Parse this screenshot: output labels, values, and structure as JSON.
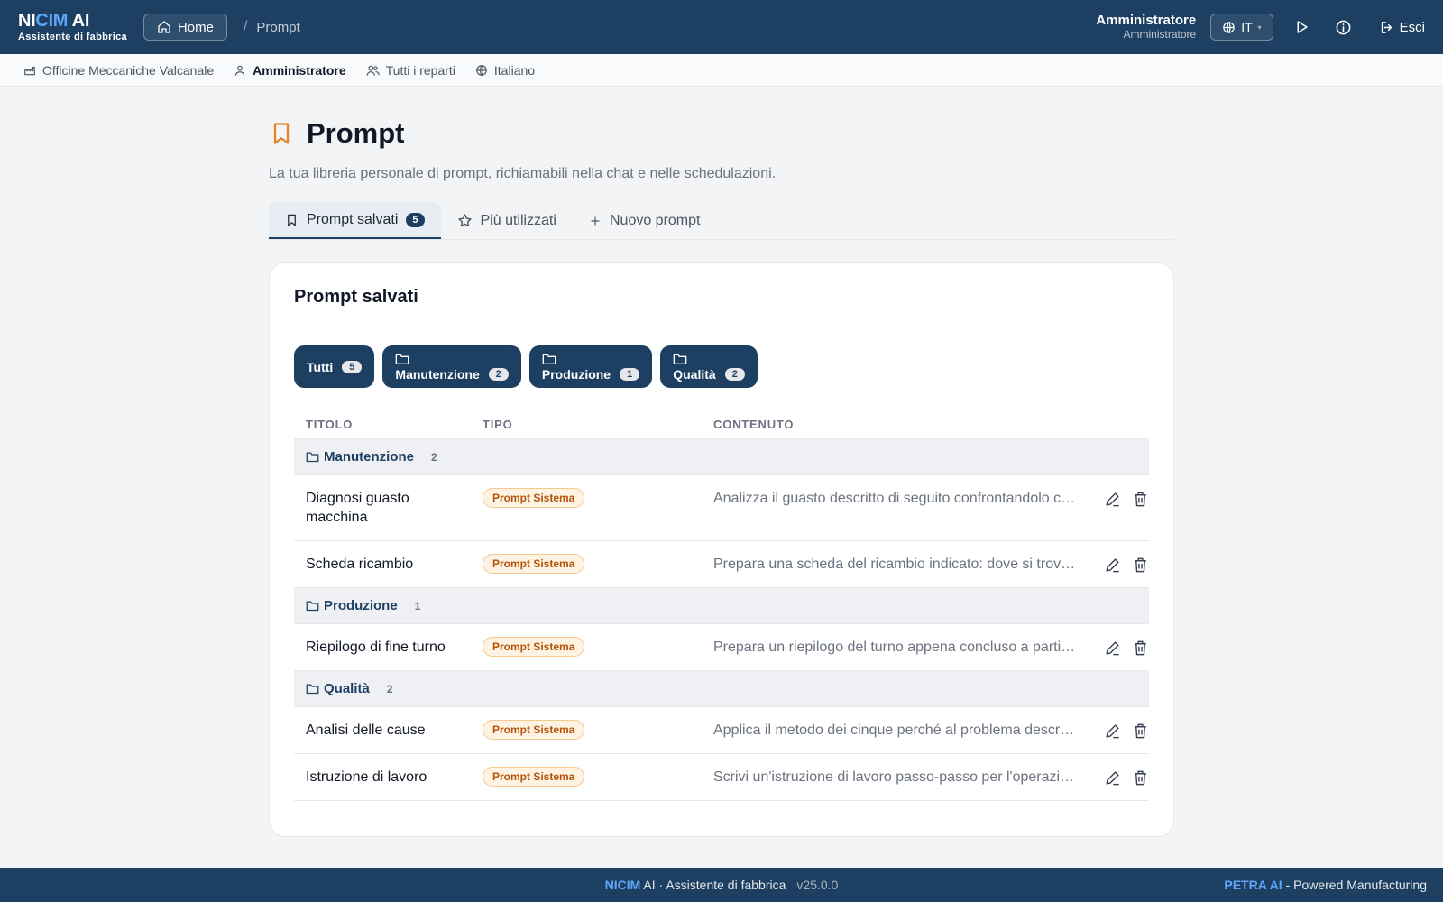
{
  "brand": {
    "name_a": "NI",
    "name_b": "CIM",
    "name_c": " AI",
    "subtitle": "Assistente di fabbrica"
  },
  "header": {
    "home_label": "Home",
    "breadcrumb_sep": "/",
    "breadcrumb_current": "Prompt",
    "user_name": "Amministratore",
    "user_role": "Amministratore",
    "language": "IT",
    "logout_label": "Esci"
  },
  "subbar": {
    "company": "Officine Meccaniche Valcanale",
    "user": "Amministratore",
    "departments": "Tutti i reparti",
    "language": "Italiano"
  },
  "page": {
    "title": "Prompt",
    "description": "La tua libreria personale di prompt, richiamabili nella chat e nelle schedulazioni."
  },
  "tabs": [
    {
      "label": "Prompt salvati",
      "count": "5"
    },
    {
      "label": "Più utilizzati"
    },
    {
      "label": "Nuovo prompt"
    }
  ],
  "card": {
    "title": "Prompt salvati",
    "filters": [
      {
        "label": "Tutti",
        "count": "5"
      },
      {
        "label": "Manutenzione",
        "count": "2"
      },
      {
        "label": "Produzione",
        "count": "1"
      },
      {
        "label": "Qualità",
        "count": "2"
      }
    ],
    "columns": {
      "title": "TITOLO",
      "type": "TIPO",
      "content": "CONTENUTO"
    },
    "groups": [
      {
        "name": "Manutenzione",
        "count": "2",
        "rows": [
          {
            "title": "Diagnosi guasto macchina",
            "type": "Prompt Sistema",
            "content": "Analizza il guasto descritto di seguito confrontandolo con lo storico interventi"
          },
          {
            "title": "Scheda ricambio",
            "type": "Prompt Sistema",
            "content": "Prepara una scheda del ricambio indicato: dove si trova a magazzino e codice"
          }
        ]
      },
      {
        "name": "Produzione",
        "count": "1",
        "rows": [
          {
            "title": "Riepilogo di fine turno",
            "type": "Prompt Sistema",
            "content": "Prepara un riepilogo del turno appena concluso a partire dai dati registrati"
          }
        ]
      },
      {
        "name": "Qualità",
        "count": "2",
        "rows": [
          {
            "title": "Analisi delle cause",
            "type": "Prompt Sistema",
            "content": "Applica il metodo dei cinque perché al problema descritto di seguito"
          },
          {
            "title": "Istruzione di lavoro",
            "type": "Prompt Sistema",
            "content": "Scrivi un'istruzione di lavoro passo-passo per l'operazione indicata"
          }
        ]
      }
    ]
  },
  "footer": {
    "brand_hl": "NICIM",
    "brand_rest": " AI · Assistente di fabbrica",
    "version": "v25.0.0",
    "right_hl": "PETRA AI",
    "right_rest": " - Powered Manufacturing"
  },
  "colors": {
    "primary": "#1d3f61",
    "accent": "#60a5fa",
    "bookmark": "#e8832a",
    "badge_text": "#b45309"
  }
}
